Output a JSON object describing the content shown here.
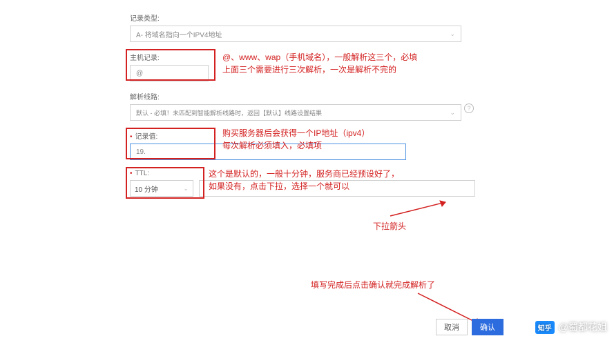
{
  "fields": {
    "recordType": {
      "label": "记录类型:",
      "value": "A- 将域名指向一个IPV4地址"
    },
    "hostRecord": {
      "label": "主机记录:",
      "value": "@"
    },
    "route": {
      "label": "解析线路:",
      "value": "默认 - 必填！未匹配到智能解析线路时，返回【默认】线路设置结果"
    },
    "recordValue": {
      "label": "记录值:",
      "value": "19."
    },
    "ttl": {
      "label": "TTL:",
      "value": "10 分钟"
    }
  },
  "annotations": {
    "hostLine1": "@、www、wap（手机域名），一般解析这三个，必填",
    "hostLine2": "上面三个需要进行三次解析，一次是解析不完的",
    "recValLine1": "购买服务器后会获得一个IP地址（ipv4）",
    "recValLine2": "每次解析必须填入，必填项",
    "ttlLine1": "这个是默认的，一般十分钟，服务商已经预设好了，",
    "ttlLine2": "如果没有，点击下拉，选择一个就可以",
    "dropdownArrow": "下拉箭头",
    "confirmNote": "填写完成后点击确认就完成解析了"
  },
  "buttons": {
    "cancel": "取消",
    "confirm": "确认"
  },
  "watermark": {
    "logo": "知乎",
    "author": "@蜀都花姐"
  },
  "helpGlyph": "?"
}
